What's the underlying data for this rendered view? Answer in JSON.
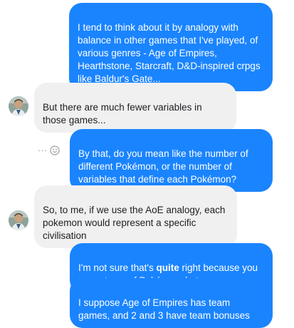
{
  "messages": [
    {
      "side": "out",
      "text": "I tend to think about it by analogy with balance in other games that I've played, of various genres - Age of Empires, Hearthstone, Starcraft, D&D-inspired crpgs like Baldur's Gate..."
    },
    {
      "side": "in",
      "text": "But there are much fewer variables in those games..."
    },
    {
      "side": "out",
      "text": "By that, do you mean like the number of different Pokémon, or the number of variables that define each Pokémon?"
    },
    {
      "side": "in",
      "text": "So, to me, if we use the AoE analogy, each pokemon would represent a specific civilisation"
    },
    {
      "side": "out",
      "text_before": "I'm not sure that's ",
      "text_bold": "quite",
      "text_after": " right because you use a team of Pokémon, but sure"
    },
    {
      "side": "out",
      "text": "I suppose Age of Empires has team games, and 2 and 3 have team bonuses"
    }
  ],
  "actions": {
    "more_glyph": "···",
    "more_icon": "more-options-icon",
    "react_icon": "smiley-icon"
  },
  "colors": {
    "outgoing_bubble": "#1a84ff",
    "incoming_bubble": "#f0f0f0",
    "outgoing_text": "#ffffff",
    "incoming_text": "#1c1e21"
  }
}
